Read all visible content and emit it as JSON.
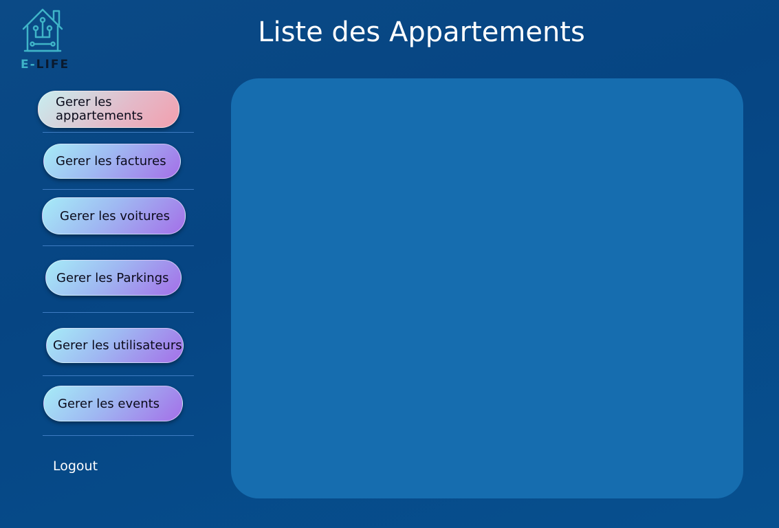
{
  "brand": {
    "logo_e": "E-",
    "logo_rest": "LIFE",
    "icon": "smart-home-icon",
    "accent_color": "#3fb4c8"
  },
  "header": {
    "title": "Liste des Appartements"
  },
  "sidebar": {
    "items": [
      {
        "label_line1": "Gerer les",
        "label_line2": "appartements",
        "active": true
      },
      {
        "label": "Gerer les factures"
      },
      {
        "label": "Gerer les voitures"
      },
      {
        "label": "Gerer les Parkings"
      },
      {
        "label": "Gerer les utilisateurs"
      },
      {
        "label": "Gerer les events"
      }
    ],
    "logout": "Logout"
  },
  "colors": {
    "background": "#064583",
    "panel": "#166daf",
    "button_gradient_start": "#a6ecf7",
    "button_gradient_end": "#a46fe8",
    "active_gradient_end": "#f29fae"
  }
}
